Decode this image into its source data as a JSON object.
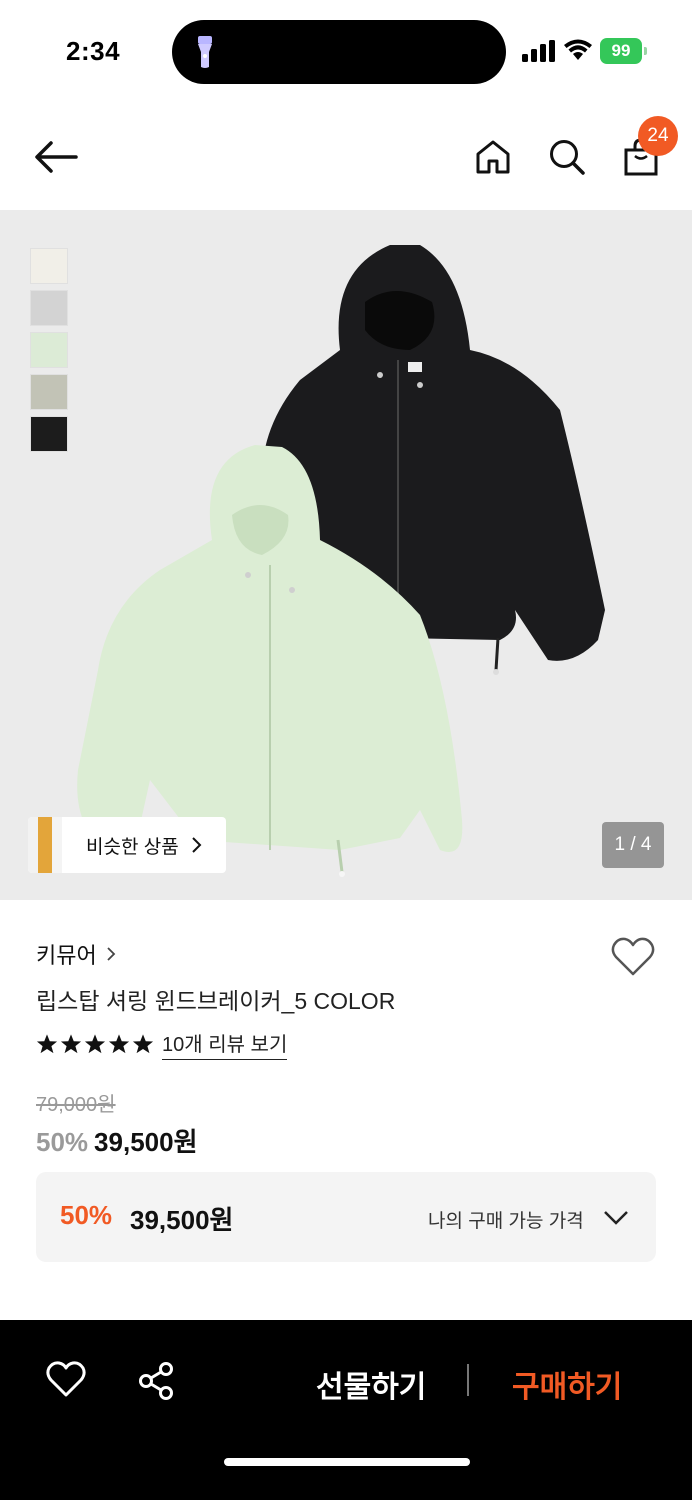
{
  "status_bar": {
    "time": "2:34",
    "battery": "99"
  },
  "header": {
    "cart_count": "24"
  },
  "hero": {
    "swatch_colors": [
      "#f1efe8",
      "#d3d3d3",
      "#dcebd6",
      "#c2c3b6",
      "#1c1c1c"
    ],
    "similar_label": "비슷한 상품",
    "image_counter": "1 / 4"
  },
  "product": {
    "brand": "키뮤어",
    "title": "립스탑 셔링 윈드브레이커_5 COLOR",
    "stars": 5,
    "review_link": "10개 리뷰 보기",
    "original_price": "79,000원",
    "discount": "50%",
    "price": "39,500원"
  },
  "my_price": {
    "discount": "50%",
    "price": "39,500원",
    "label": "나의 구매 가능 가격"
  },
  "bottom_bar": {
    "gift_label": "선물하기",
    "buy_label": "구매하기"
  },
  "colors": {
    "accent": "#f15a24",
    "badge": "#f15a24",
    "battery": "#34c759"
  }
}
